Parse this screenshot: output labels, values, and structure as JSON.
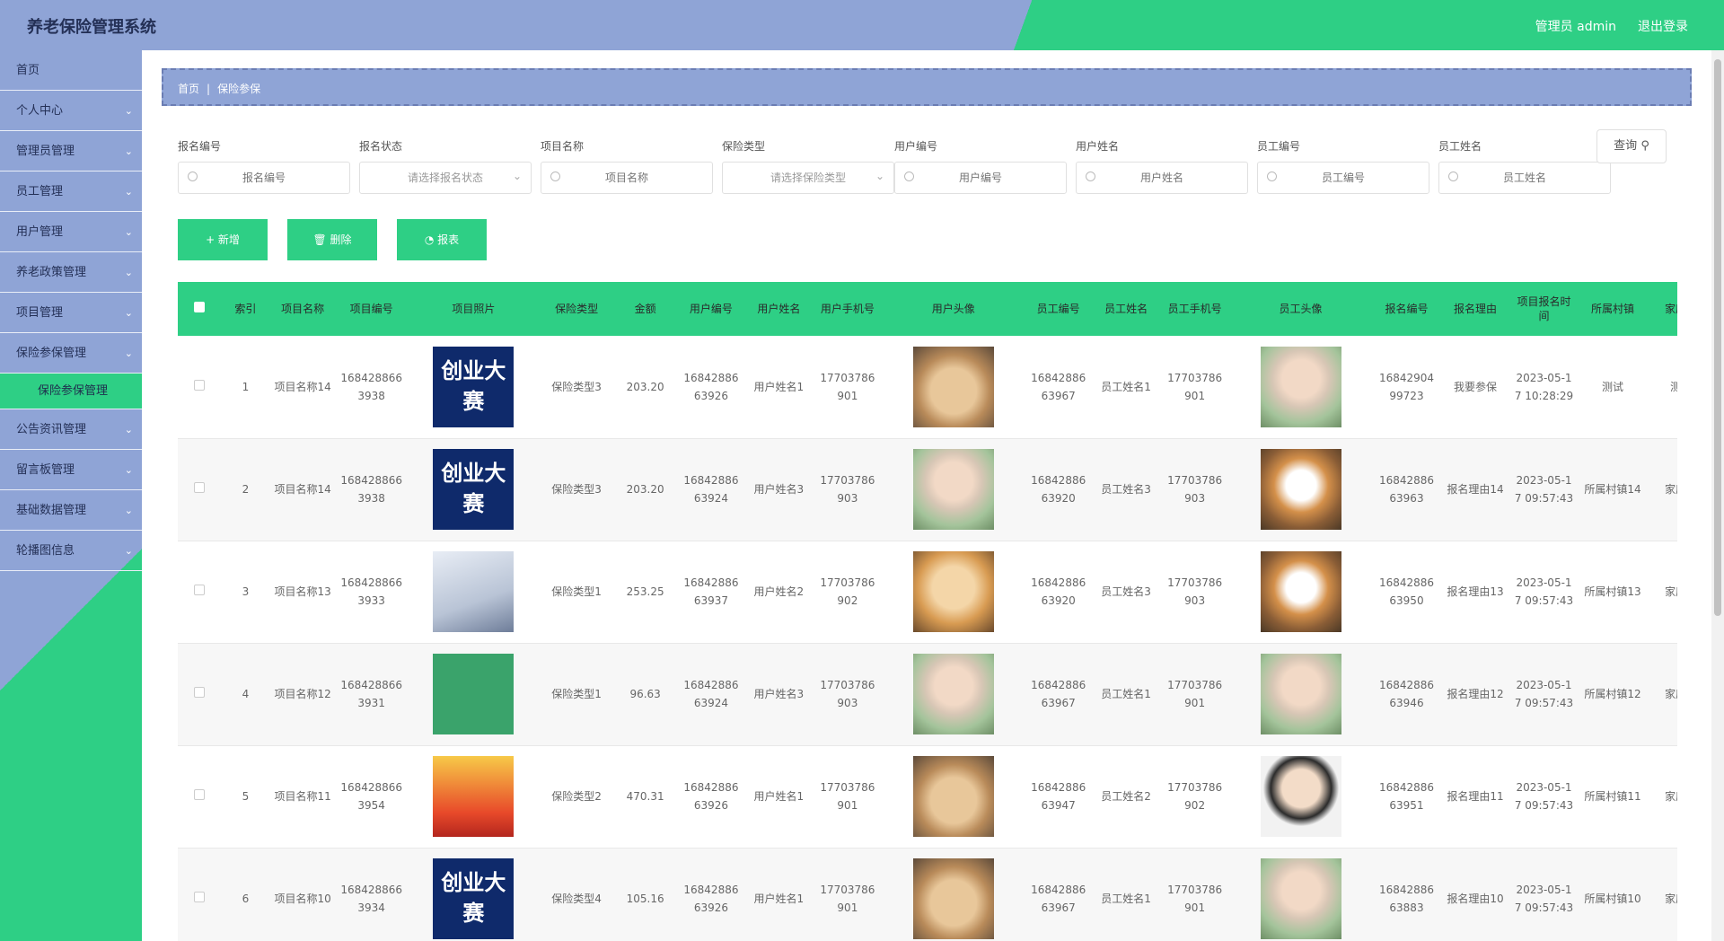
{
  "header": {
    "title": "养老保险管理系统",
    "admin": "管理员 admin",
    "logout": "退出登录"
  },
  "sidebar": {
    "items": [
      {
        "label": "首页"
      },
      {
        "label": "个人中心"
      },
      {
        "label": "管理员管理"
      },
      {
        "label": "员工管理"
      },
      {
        "label": "用户管理"
      },
      {
        "label": "养老政策管理"
      },
      {
        "label": "项目管理"
      },
      {
        "label": "保险参保管理"
      },
      {
        "label": "公告资讯管理"
      },
      {
        "label": "留言板管理"
      },
      {
        "label": "基础数据管理"
      },
      {
        "label": "轮播图信息"
      }
    ],
    "active_sub": "保险参保管理"
  },
  "breadcrumb": {
    "home": "首页",
    "current": "保险参保"
  },
  "filters": [
    {
      "label": "报名编号",
      "placeholder": "报名编号",
      "type": "input"
    },
    {
      "label": "报名状态",
      "placeholder": "请选择报名状态",
      "type": "select"
    },
    {
      "label": "项目名称",
      "placeholder": "项目名称",
      "type": "input"
    },
    {
      "label": "保险类型",
      "placeholder": "请选择保险类型",
      "type": "select"
    },
    {
      "label": "用户编号",
      "placeholder": "用户编号",
      "type": "input"
    },
    {
      "label": "用户姓名",
      "placeholder": "用户姓名",
      "type": "input"
    },
    {
      "label": "员工编号",
      "placeholder": "员工编号",
      "type": "input"
    },
    {
      "label": "员工姓名",
      "placeholder": "员工姓名",
      "type": "input"
    }
  ],
  "query_label": "查询",
  "actions": {
    "add": "+ 新增",
    "delete": "删除",
    "report": "报表"
  },
  "table": {
    "headers": [
      "索引",
      "项目名称",
      "项目编号",
      "项目照片",
      "保险类型",
      "金额",
      "用户编号",
      "用户姓名",
      "用户手机号",
      "用户头像",
      "员工编号",
      "员工姓名",
      "员工手机号",
      "员工头像",
      "报名编号",
      "报名理由",
      "项目报名时间",
      "所属村镇",
      "家庭"
    ],
    "rows": [
      {
        "idx": "1",
        "proj_name": "项目名称14",
        "proj_no": "1684288663938",
        "proj_img": "创业大赛",
        "ins_type": "保险类型3",
        "amount": "203.20",
        "user_no": "1684288663926",
        "user_name": "用户姓名1",
        "user_phone": "17703786901",
        "user_avatar": "cat",
        "staff_no": "1684288663967",
        "staff_name": "员工姓名1",
        "staff_phone": "17703786901",
        "staff_avatar": "man",
        "reg_no": "1684290499723",
        "reason": "我要参保",
        "time": "2023-05-17 10:28:29",
        "village": "测试",
        "family": "测"
      },
      {
        "idx": "2",
        "proj_name": "项目名称14",
        "proj_no": "1684288663938",
        "proj_img": "创业大赛",
        "ins_type": "保险类型3",
        "amount": "203.20",
        "user_no": "1684288663924",
        "user_name": "用户姓名3",
        "user_phone": "17703786903",
        "user_avatar": "man",
        "staff_no": "1684288663920",
        "staff_name": "员工姓名3",
        "staff_phone": "17703786903",
        "staff_avatar": "shiba",
        "reg_no": "1684288663963",
        "reason": "报名理由14",
        "time": "2023-05-17 09:57:43",
        "village": "所属村镇14",
        "family": "家庭"
      },
      {
        "idx": "3",
        "proj_name": "项目名称13",
        "proj_no": "1684288663933",
        "proj_img": "photo-house",
        "ins_type": "保险类型1",
        "amount": "253.25",
        "user_no": "1684288663937",
        "user_name": "用户姓名2",
        "user_phone": "17703786902",
        "user_avatar": "dog",
        "staff_no": "1684288663920",
        "staff_name": "员工姓名3",
        "staff_phone": "17703786903",
        "staff_avatar": "shiba",
        "reg_no": "1684288663950",
        "reason": "报名理由13",
        "time": "2023-05-17 09:57:43",
        "village": "所属村镇13",
        "family": "家庭"
      },
      {
        "idx": "4",
        "proj_name": "项目名称12",
        "proj_no": "1684288663931",
        "proj_img": "photo-gears",
        "ins_type": "保险类型1",
        "amount": "96.63",
        "user_no": "1684288663924",
        "user_name": "用户姓名3",
        "user_phone": "17703786903",
        "user_avatar": "man",
        "staff_no": "1684288663967",
        "staff_name": "员工姓名1",
        "staff_phone": "17703786901",
        "staff_avatar": "man",
        "reg_no": "1684288663946",
        "reason": "报名理由12",
        "time": "2023-05-17 09:57:43",
        "village": "所属村镇12",
        "family": "家庭"
      },
      {
        "idx": "5",
        "proj_name": "项目名称11",
        "proj_no": "1684288663954",
        "proj_img": "photo-poster",
        "ins_type": "保险类型2",
        "amount": "470.31",
        "user_no": "1684288663926",
        "user_name": "用户姓名1",
        "user_phone": "17703786901",
        "user_avatar": "cat",
        "staff_no": "1684288663947",
        "staff_name": "员工姓名2",
        "staff_phone": "17703786902",
        "staff_avatar": "guy",
        "reg_no": "1684288663951",
        "reason": "报名理由11",
        "time": "2023-05-17 09:57:43",
        "village": "所属村镇11",
        "family": "家庭"
      },
      {
        "idx": "6",
        "proj_name": "项目名称10",
        "proj_no": "1684288663934",
        "proj_img": "创业大赛",
        "ins_type": "保险类型4",
        "amount": "105.16",
        "user_no": "1684288663926",
        "user_name": "用户姓名1",
        "user_phone": "17703786901",
        "user_avatar": "cat",
        "staff_no": "1684288663967",
        "staff_name": "员工姓名1",
        "staff_phone": "17703786901",
        "staff_avatar": "man",
        "reg_no": "1684288663883",
        "reason": "报名理由10",
        "time": "2023-05-17 09:57:43",
        "village": "所属村镇10",
        "family": "家庭"
      }
    ]
  }
}
